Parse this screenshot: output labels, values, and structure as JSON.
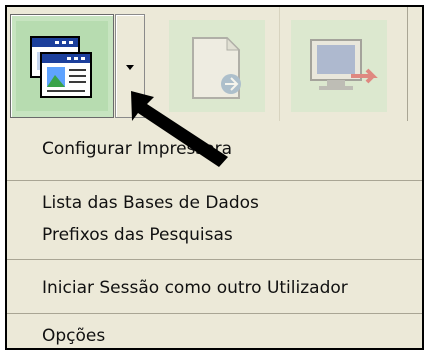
{
  "toolbar": {
    "buttons": [
      {
        "icon": "windows-icon"
      },
      {
        "icon": "document-export-icon"
      },
      {
        "icon": "monitor-logout-icon"
      }
    ],
    "dropdown_icon": "chevron-down-icon"
  },
  "menu": {
    "items": [
      {
        "label": "Configurar Impressora"
      },
      {
        "label": "Lista das Bases de Dados"
      },
      {
        "label": "Prefixos das Pesquisas"
      },
      {
        "label": "Iniciar Sessão como outro Utilizador"
      },
      {
        "label": "Opções"
      }
    ]
  },
  "annotation": {
    "icon": "pointer-arrow-icon",
    "color": "#000000"
  },
  "colors": {
    "menu_background": "#ece9d8",
    "button_active_background": "#c7e4c0"
  }
}
